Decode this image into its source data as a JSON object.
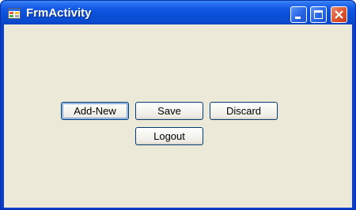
{
  "window": {
    "title": "FrmActivity",
    "icons": {
      "app": "form-icon",
      "minimize": "minimize-icon",
      "maximize": "maximize-icon",
      "close": "close-icon"
    }
  },
  "buttons": {
    "add_new": "Add-New",
    "save": "Save",
    "discard": "Discard",
    "logout": "Logout"
  },
  "colors": {
    "titlebar": "#0a4fd8",
    "client_background": "#ece9d8",
    "close_button": "#e0532e",
    "button_border": "#003c74"
  }
}
